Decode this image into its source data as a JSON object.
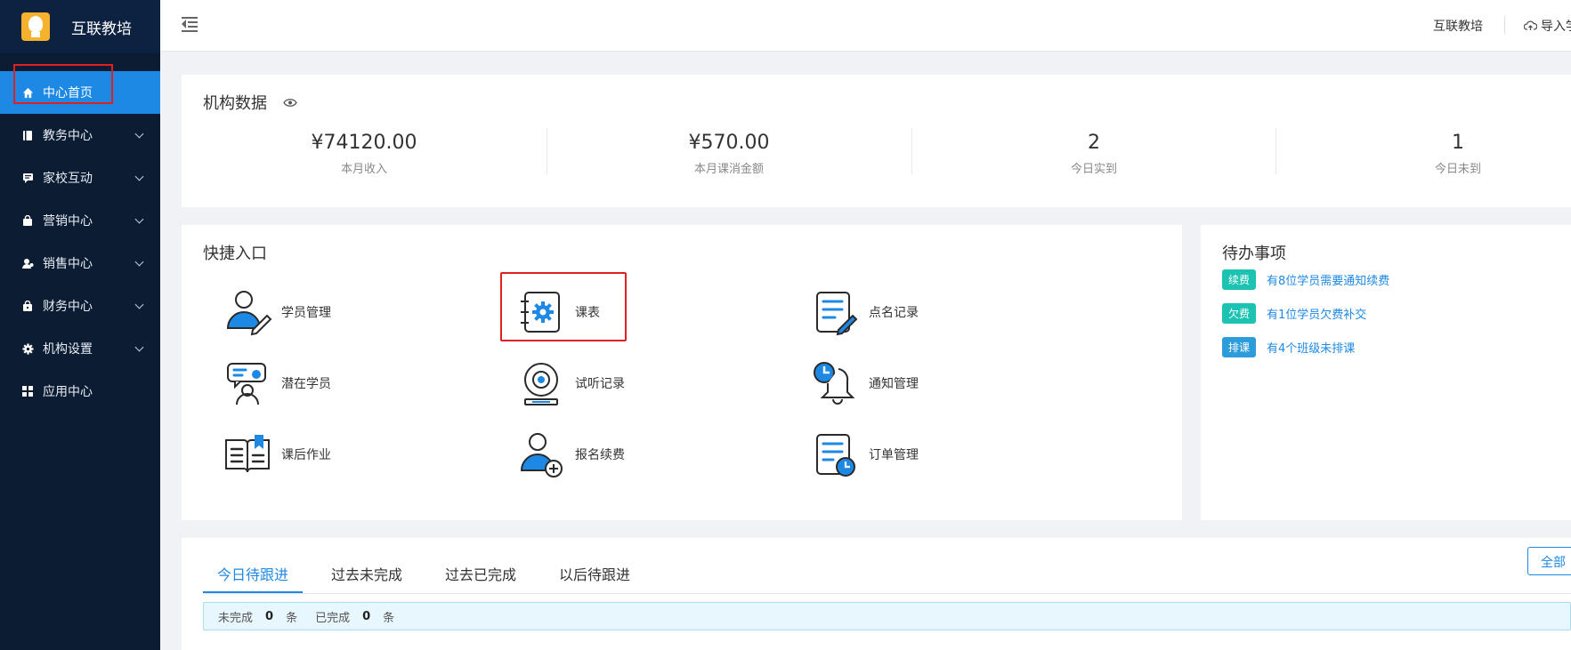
{
  "brand": {
    "name": "互联教培",
    "logo_icon": "bulb-logo-icon"
  },
  "sidebar": {
    "items": [
      {
        "label": "中心首页",
        "icon": "home-icon",
        "active": true
      },
      {
        "label": "教务中心",
        "icon": "book-icon"
      },
      {
        "label": "家校互动",
        "icon": "chat-icon"
      },
      {
        "label": "营销中心",
        "icon": "bag-icon"
      },
      {
        "label": "销售中心",
        "icon": "user-icon"
      },
      {
        "label": "财务中心",
        "icon": "wallet-icon"
      },
      {
        "label": "机构设置",
        "icon": "gear-icon"
      },
      {
        "label": "应用中心",
        "icon": "grid-icon"
      }
    ]
  },
  "topbar": {
    "org_name": "互联教培",
    "import_label": "导入学"
  },
  "org_data": {
    "title": "机构数据",
    "stats": [
      {
        "value": "¥74120.00",
        "label": "本月收入"
      },
      {
        "value": "¥570.00",
        "label": "本月课消金额"
      },
      {
        "value": "2",
        "label": "今日实到"
      },
      {
        "value": "1",
        "label": "今日未到"
      }
    ]
  },
  "quick": {
    "title": "快捷入口",
    "items": [
      {
        "label": "学员管理",
        "icon": "student-edit-icon"
      },
      {
        "label": "课表",
        "icon": "schedule-gear-icon"
      },
      {
        "label": "点名记录",
        "icon": "rollcall-record-icon"
      },
      {
        "label": "潜在学员",
        "icon": "potential-student-icon"
      },
      {
        "label": "试听记录",
        "icon": "trial-record-icon"
      },
      {
        "label": "通知管理",
        "icon": "bell-clock-icon"
      },
      {
        "label": "课后作业",
        "icon": "homework-book-icon"
      },
      {
        "label": "报名续费",
        "icon": "enroll-add-icon"
      },
      {
        "label": "订单管理",
        "icon": "order-clock-icon"
      }
    ]
  },
  "todo": {
    "title": "待办事项",
    "items": [
      {
        "badge": "续费",
        "text": "有8位学员需要通知续费",
        "color": "#1cc3b2"
      },
      {
        "badge": "欠费",
        "text": "有1位学员欠费补交",
        "color": "#1cc3b2"
      },
      {
        "badge": "排课",
        "text": "有4个班级未排课",
        "color": "#2d9cdb"
      }
    ]
  },
  "follow": {
    "tabs": [
      "今日待跟进",
      "过去未完成",
      "过去已完成",
      "以后待跟进"
    ],
    "all_label": "全部",
    "summary": {
      "incomplete_label": "未完成",
      "incomplete_count": "0",
      "complete_label": "已完成",
      "complete_count": "0",
      "unit": "条"
    }
  },
  "colors": {
    "accent": "#1e88e5",
    "sidebar_bg": "#0b1c33",
    "highlight": "#e02020"
  }
}
